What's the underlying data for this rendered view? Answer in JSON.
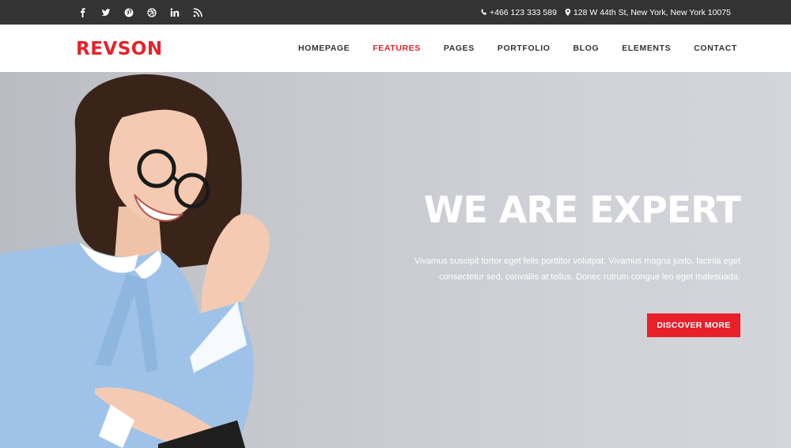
{
  "topbar": {
    "social": [
      "facebook-icon",
      "twitter-icon",
      "pinterest-icon",
      "dribbble-icon",
      "linkedin-icon",
      "rss-icon"
    ],
    "phone": "+466 123 333 589",
    "address": "128 W 44th St, New York, New York 10075"
  },
  "header": {
    "logo": "REVSON",
    "nav": [
      "HOMEPAGE",
      "FEATURES",
      "PAGES",
      "PORTFOLIO",
      "BLOG",
      "ELEMENTS",
      "CONTACT"
    ],
    "active_nav": "FEATURES"
  },
  "hero": {
    "title": "WE ARE EXPERT",
    "text": "Vivamus suscipit tortor eget felis porttitor volutpat. Vivamus magna justo, lacinia eget consectetur sed, convallis at tellus. Donec rutrum congue leo eget malesuada.",
    "button": "DISCOVER MORE"
  },
  "colors": {
    "accent": "#e8202a",
    "topbar": "#333333"
  }
}
